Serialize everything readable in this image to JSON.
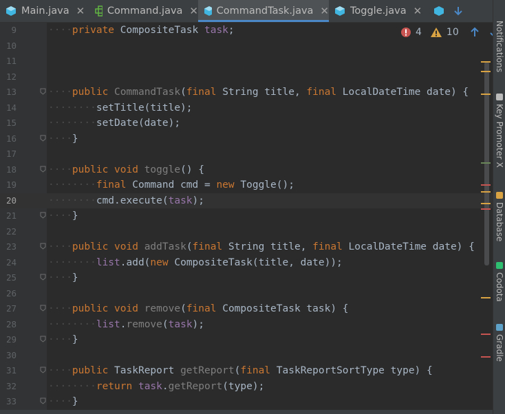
{
  "tabs": [
    {
      "label": "Main.java",
      "icon": "java-class-icon",
      "active": false
    },
    {
      "label": "Command.java",
      "icon": "interface-icon",
      "active": false
    },
    {
      "label": "CommandTask.java",
      "icon": "java-class-icon",
      "active": true
    },
    {
      "label": "Toggle.java",
      "icon": "java-class-icon",
      "active": false
    }
  ],
  "close_glyph": "✕",
  "inspection": {
    "errors": "4",
    "warnings": "10"
  },
  "right_tools": [
    "Notifications",
    "Key Promoter X",
    "Database",
    "Codota",
    "Gradle"
  ],
  "current_line": "20",
  "lines": [
    {
      "n": "9",
      "text": "    private CompositeTask task;"
    },
    {
      "n": "10",
      "text": ""
    },
    {
      "n": "11",
      "text": ""
    },
    {
      "n": "12",
      "text": ""
    },
    {
      "n": "13",
      "text": "    public CommandTask(final String title, final LocalDateTime date) {"
    },
    {
      "n": "14",
      "text": "        setTitle(title);"
    },
    {
      "n": "15",
      "text": "        setDate(date);"
    },
    {
      "n": "16",
      "text": "    }"
    },
    {
      "n": "17",
      "text": ""
    },
    {
      "n": "18",
      "text": "    public void toggle() {"
    },
    {
      "n": "19",
      "text": "        final Command cmd = new Toggle();"
    },
    {
      "n": "20",
      "text": "        cmd.execute(task);"
    },
    {
      "n": "21",
      "text": "    }"
    },
    {
      "n": "22",
      "text": ""
    },
    {
      "n": "23",
      "text": "    public void addTask(final String title, final LocalDateTime date) {"
    },
    {
      "n": "24",
      "text": "        list.add(new CompositeTask(title, date));"
    },
    {
      "n": "25",
      "text": "    }"
    },
    {
      "n": "26",
      "text": ""
    },
    {
      "n": "27",
      "text": "    public void remove(final CompositeTask task) {"
    },
    {
      "n": "28",
      "text": "        list.remove(task);"
    },
    {
      "n": "29",
      "text": "    }"
    },
    {
      "n": "30",
      "text": ""
    },
    {
      "n": "31",
      "text": "    public TaskReport getReport(final TaskReportSortType type) {"
    },
    {
      "n": "32",
      "text": "        return task.getReport(type);"
    },
    {
      "n": "33",
      "text": "    }"
    }
  ],
  "colors": {
    "keyword": "#cc7832",
    "field": "#9876aa",
    "method": "#ffc66d",
    "text": "#a9b7c6",
    "error": "#c75450",
    "warning": "#d9a343",
    "tab_underline": "#4a88c7"
  }
}
